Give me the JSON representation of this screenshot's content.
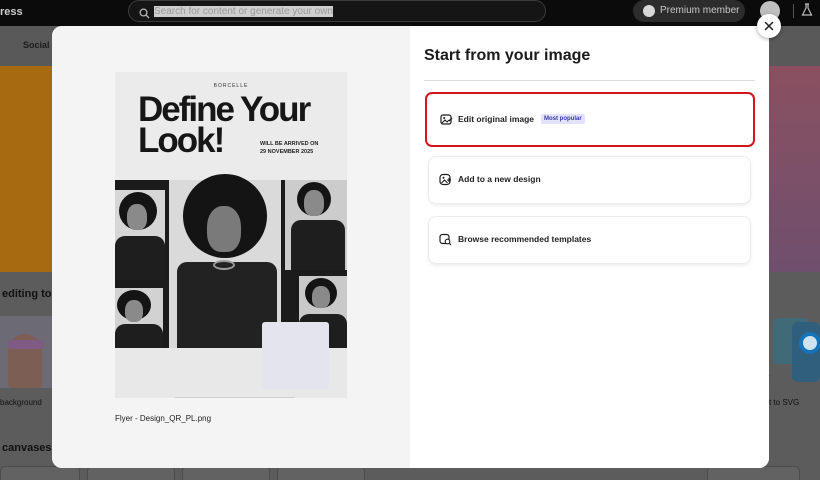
{
  "app": {
    "brand_fragment": "ress",
    "search": {
      "placeholder": "Search for content or generate your own"
    },
    "premium_label": "Premium member"
  },
  "background": {
    "tab_social": "Social m",
    "section_editing": "editing too",
    "thumb_left_caption": "background",
    "thumb_right_caption": "t to SVG",
    "section_canvases": "canvases"
  },
  "modal": {
    "preview": {
      "brand": "BORCELLE",
      "headline_line1": "Define Your",
      "headline_line2": "Look!",
      "sub_line1": "WILL BE ARRIVED ON",
      "sub_line2": "29 NOVEMBER 2025",
      "filename": "Flyer - Design_QR_PL.png"
    },
    "title": "Start from your image",
    "options": [
      {
        "label": "Edit original image",
        "badge": "Most popular",
        "icon": "edit-image-icon",
        "selected": true
      },
      {
        "label": "Add to a new design",
        "icon": "new-design-icon",
        "selected": false
      },
      {
        "label": "Browse recommended templates",
        "icon": "template-search-icon",
        "selected": false
      }
    ],
    "accent_color": "#d2161b",
    "badge_color": "#e2e2fb"
  }
}
